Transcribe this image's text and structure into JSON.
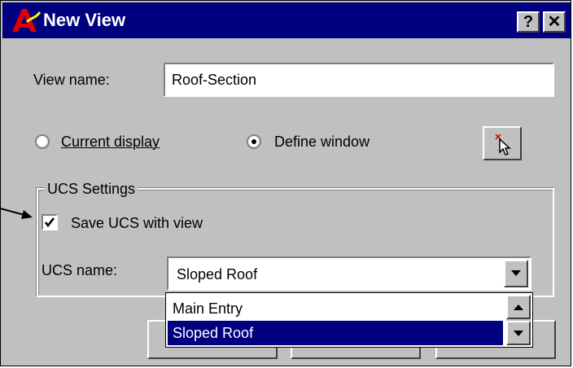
{
  "window": {
    "title": "New View",
    "help_button": "?",
    "close_button": "✕"
  },
  "view_name": {
    "label": "View name:",
    "value": "Roof-Section"
  },
  "display_options": {
    "current_display": {
      "label": "Current display",
      "selected": false
    },
    "define_window": {
      "label": "Define window",
      "selected": true
    }
  },
  "ucs_settings": {
    "group_title": "UCS Settings",
    "save_ucs_label": "Save UCS with view",
    "save_ucs_checked": true,
    "ucs_name_label": "UCS name:",
    "ucs_name_value": "Sloped Roof",
    "dropdown_options": [
      "Main Entry",
      "Sloped Roof"
    ],
    "selected_option": "Sloped Roof"
  },
  "icons": {
    "app": "autocad-logo-icon",
    "pick_window": "pick-cursor-icon",
    "dropdown": "chevron-down-icon",
    "callout": "arrow-pointer-icon"
  },
  "colors": {
    "titlebar": "#000080",
    "face": "#c0c0c0",
    "selection": "#000080"
  }
}
